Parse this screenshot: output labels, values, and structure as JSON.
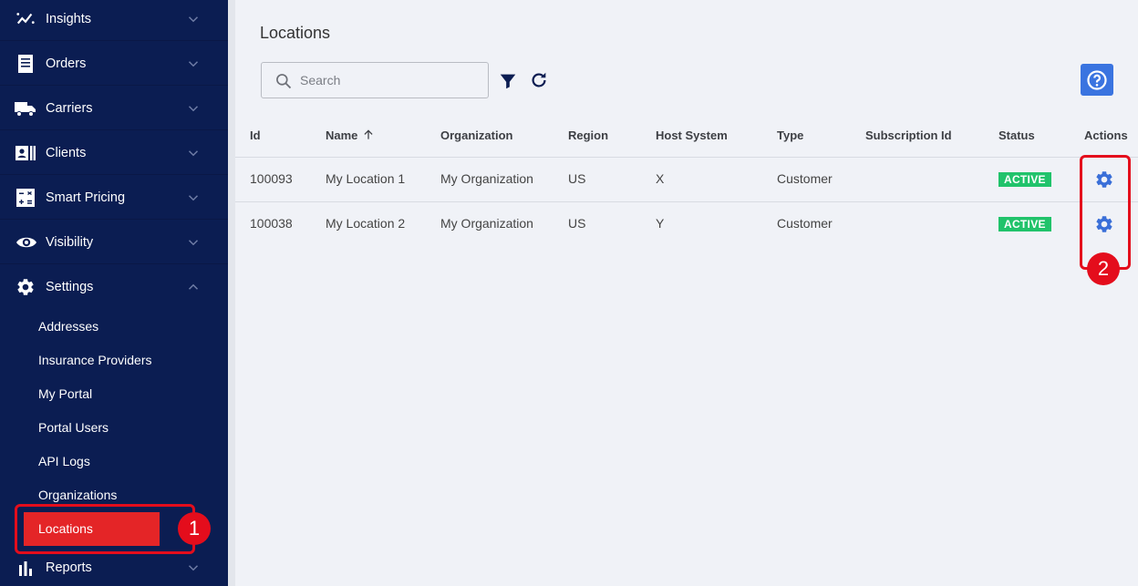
{
  "sidebar": {
    "items": [
      {
        "label": "Insights",
        "icon": "chart-line-icon"
      },
      {
        "label": "Orders",
        "icon": "receipt-icon"
      },
      {
        "label": "Carriers",
        "icon": "truck-icon"
      },
      {
        "label": "Clients",
        "icon": "contact-card-icon"
      },
      {
        "label": "Smart Pricing",
        "icon": "calculator-icon"
      },
      {
        "label": "Visibility",
        "icon": "eye-icon"
      },
      {
        "label": "Settings",
        "icon": "gear-icon"
      },
      {
        "label": "Reports",
        "icon": "bar-chart-icon"
      }
    ],
    "settings_children": [
      "Addresses",
      "Insurance Providers",
      "My Portal",
      "Portal Users",
      "API Logs",
      "Organizations",
      "Locations"
    ],
    "active_child": "Locations"
  },
  "main": {
    "title": "Locations",
    "search_placeholder": "Search",
    "table": {
      "columns": [
        "Id",
        "Name",
        "Organization",
        "Region",
        "Host System",
        "Type",
        "Subscription Id",
        "Status",
        "Actions"
      ],
      "rows": [
        {
          "id": "100093",
          "name": "My Location 1",
          "organization": "My Organization",
          "region": "US",
          "host": "X",
          "type": "Customer",
          "subscription": "",
          "status": "ACTIVE"
        },
        {
          "id": "100038",
          "name": "My Location 2",
          "organization": "My Organization",
          "region": "US",
          "host": "Y",
          "type": "Customer",
          "subscription": "",
          "status": "ACTIVE"
        }
      ]
    }
  },
  "annotations": {
    "first": "1",
    "second": "2"
  },
  "colors": {
    "sidebar": "#0b1d52",
    "active": "#e42527",
    "accent": "#3a74e0",
    "status_active": "#21c36b",
    "annotation": "#e40d1c"
  }
}
